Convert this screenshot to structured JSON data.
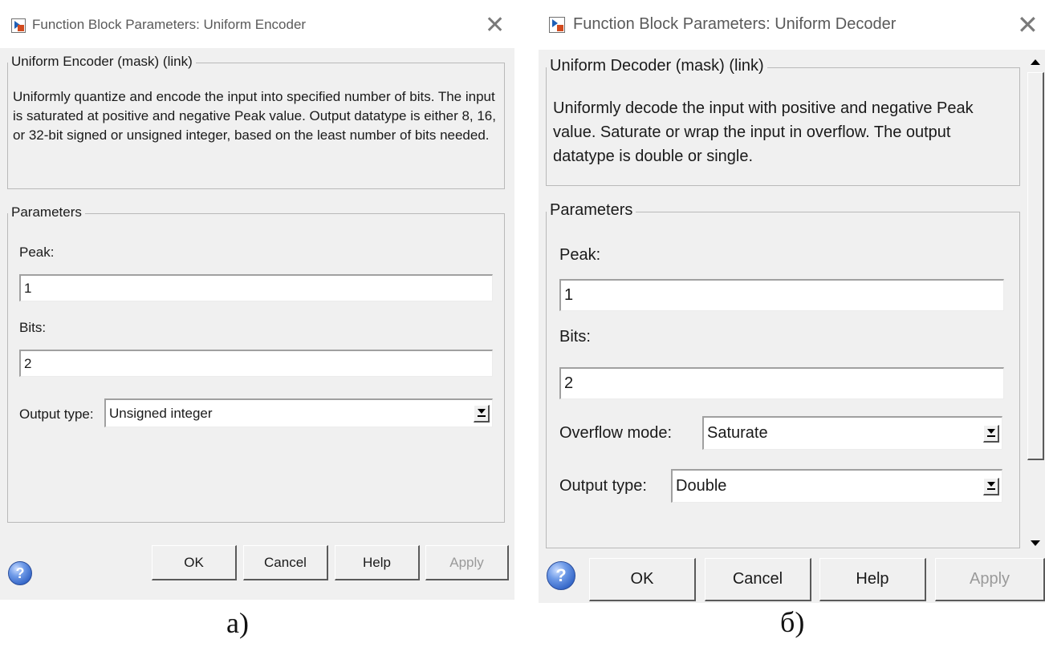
{
  "dialog_a": {
    "title": "Function Block Parameters: Uniform Encoder",
    "mask_group": "Uniform Encoder (mask) (link)",
    "description": "Uniformly quantize and encode the input into specified number of bits. The input is saturated at positive and negative Peak value. Output datatype is either 8, 16, or 32-bit signed or unsigned integer, based on the least number of bits needed.",
    "params_group": "Parameters",
    "peak_label": "Peak:",
    "peak_value": "1",
    "bits_label": "Bits:",
    "bits_value": "2",
    "output_type_label": "Output type:",
    "output_type_value": "Unsigned integer",
    "buttons": {
      "ok": "OK",
      "cancel": "Cancel",
      "help": "Help",
      "apply": "Apply"
    },
    "caption": "a)"
  },
  "dialog_b": {
    "title": "Function Block Parameters: Uniform Decoder",
    "mask_group": "Uniform Decoder (mask) (link)",
    "description": "Uniformly decode the input with positive and negative Peak value.   Saturate or wrap the input in overflow. The  output datatype is double or single.",
    "params_group": "Parameters",
    "peak_label": "Peak:",
    "peak_value": "1",
    "bits_label": "Bits:",
    "bits_value": "2",
    "overflow_label": "Overflow mode:",
    "overflow_value": "Saturate",
    "output_type_label": "Output type:",
    "output_type_value": "Double",
    "buttons": {
      "ok": "OK",
      "cancel": "Cancel",
      "help": "Help",
      "apply": "Apply"
    },
    "caption": "б)"
  },
  "colors": {
    "dialog_bg": "#f0f0f0",
    "titlebar_bg": "#ffffff",
    "disabled_text": "#9a9a9a"
  }
}
